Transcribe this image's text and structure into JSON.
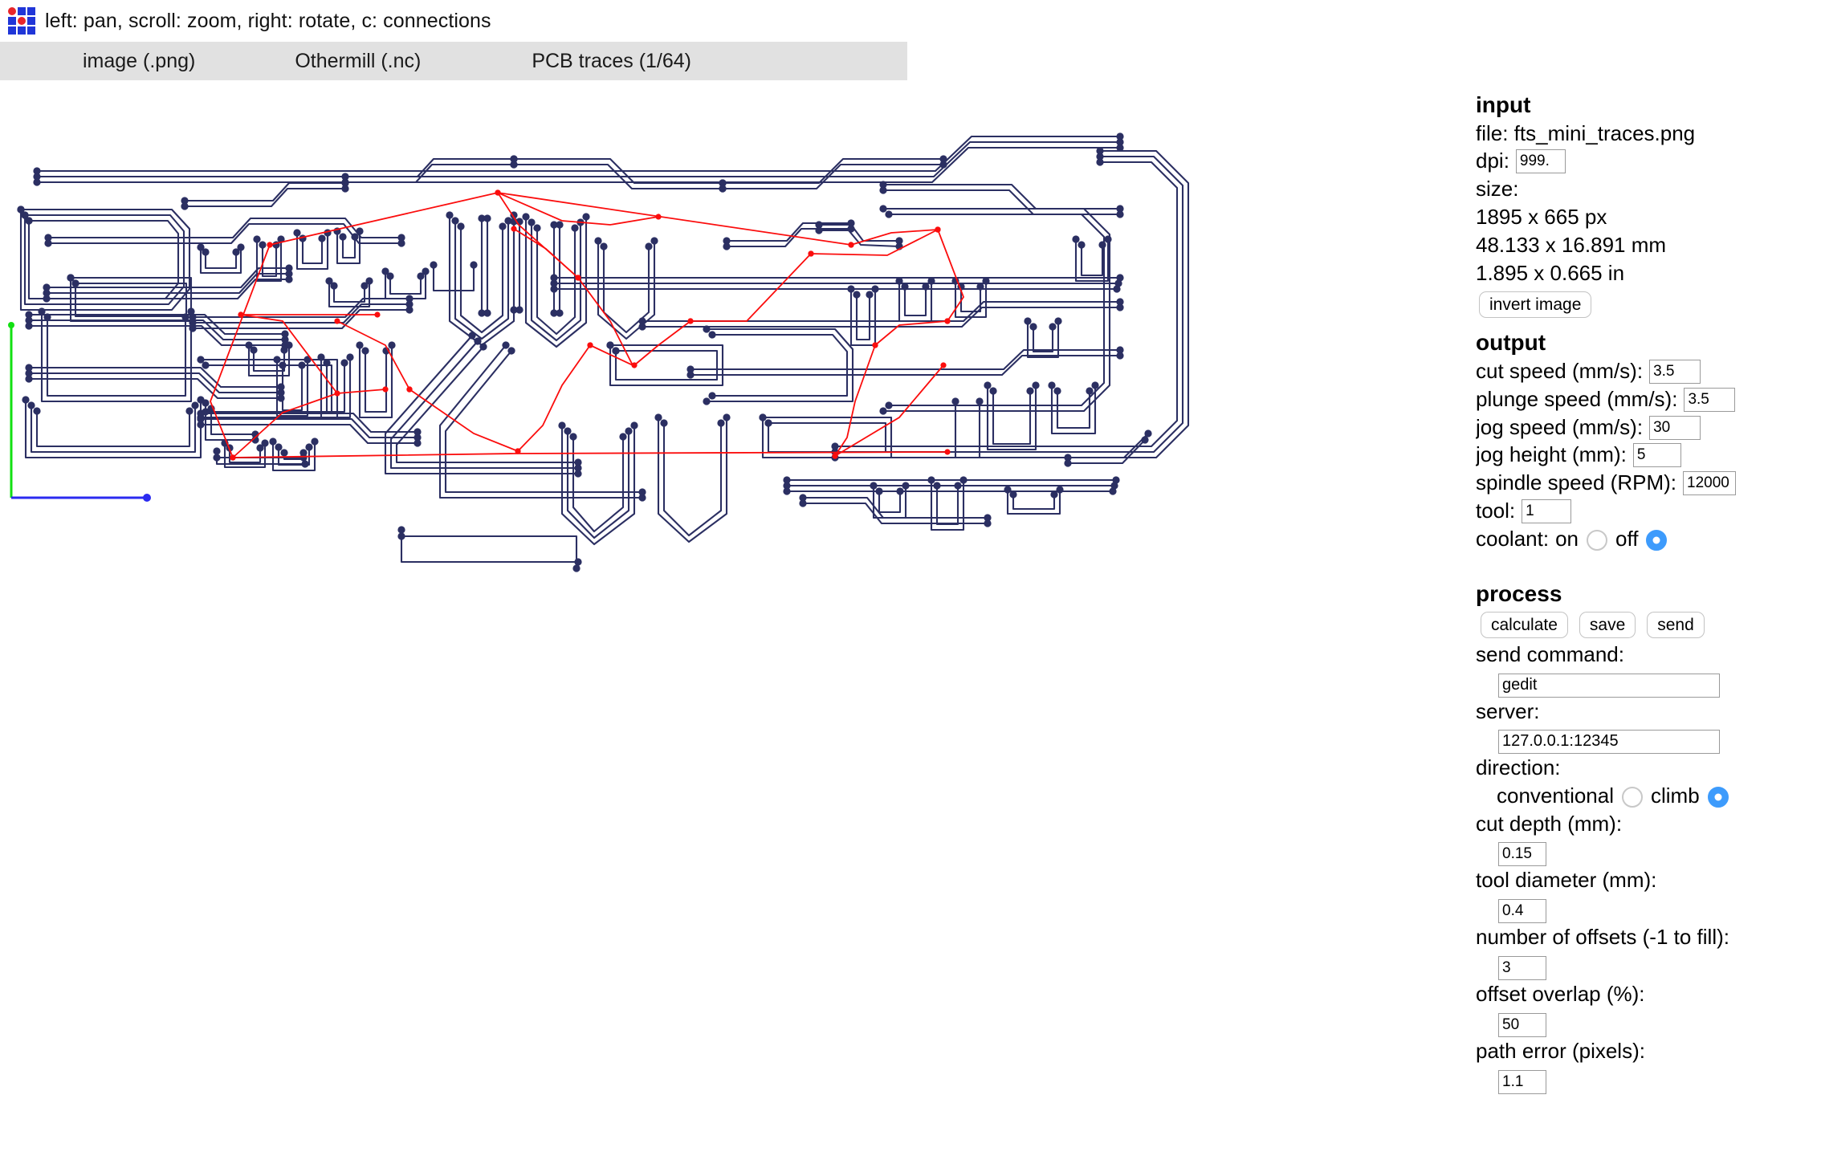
{
  "app": {
    "hint": "left: pan, scroll: zoom, right: rotate, c: connections",
    "logo_name": "mods-logo"
  },
  "tabs": [
    {
      "label": "image (.png)"
    },
    {
      "label": "Othermill (.nc)"
    },
    {
      "label": "PCB traces (1/64)"
    }
  ],
  "input": {
    "title": "input",
    "file_label": "file: fts_mini_traces.png",
    "dpi_label": "dpi:",
    "dpi_value": "999.",
    "size_label": "size:",
    "size_px": "1895 x 665 px",
    "size_mm": "48.133 x 16.891 mm",
    "size_in": "1.895 x 0.665 in",
    "invert_label": "invert image"
  },
  "output": {
    "title": "output",
    "cut_speed_label": "cut speed (mm/s):",
    "cut_speed_value": "3.5",
    "plunge_speed_label": "plunge speed (mm/s):",
    "plunge_speed_value": "3.5",
    "jog_speed_label": "jog speed (mm/s):",
    "jog_speed_value": "30",
    "jog_height_label": "jog height (mm):",
    "jog_height_value": "5",
    "spindle_speed_label": "spindle speed (RPM):",
    "spindle_speed_value": "12000",
    "tool_label": "tool:",
    "tool_value": "1",
    "coolant_label": "coolant:",
    "coolant_on_label": "on",
    "coolant_off_label": "off",
    "coolant_selected": "off"
  },
  "process": {
    "title": "process",
    "calculate_label": "calculate",
    "save_label": "save",
    "send_label": "send",
    "send_command_label": "send command:",
    "send_command_value": "gedit",
    "server_label": "server:",
    "server_value": "127.0.0.1:12345",
    "direction_label": "direction:",
    "direction_conventional_label": "conventional",
    "direction_climb_label": "climb",
    "direction_selected": "climb",
    "cut_depth_label": "cut depth (mm):",
    "cut_depth_value": "0.15",
    "tool_diameter_label": "tool diameter (mm):",
    "tool_diameter_value": "0.4",
    "offsets_label": "number of offsets (-1 to fill):",
    "offsets_value": "3",
    "offset_overlap_label": "offset overlap (%):",
    "offset_overlap_value": "50",
    "path_error_label": "path error (pixels):",
    "path_error_value": "1.1"
  },
  "viewport": {
    "toolpath_color": "#2b2f62",
    "jog_color": "#fb0d0d",
    "axis_x_color": "#2b2bf0",
    "axis_y_color": "#12e012",
    "background": "#ffffff"
  }
}
